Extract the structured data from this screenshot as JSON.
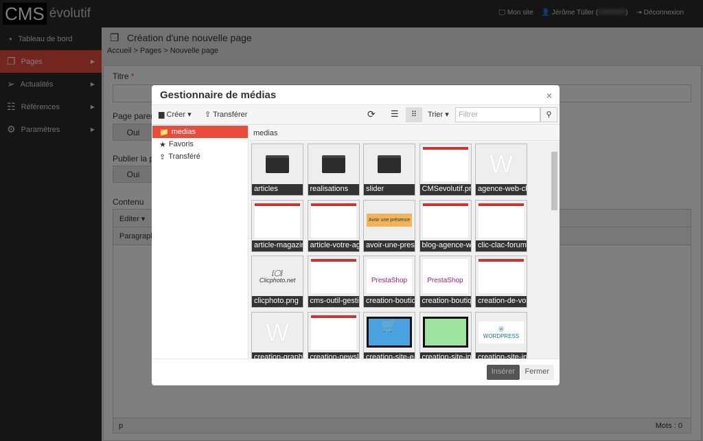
{
  "topbar": {
    "logo_cms": "CMS",
    "logo_evo": "évolutif",
    "my_site": "Mon site",
    "user": "Jérôme Tüller (",
    "user_end": ")",
    "logout": "Déconnexion"
  },
  "sidebar": {
    "items": [
      {
        "label": "Tableau de bord",
        "icon": "dashboard-icon"
      },
      {
        "label": "Pages",
        "icon": "pages-icon",
        "active": true
      },
      {
        "label": "Actualités",
        "icon": "paper-plane-icon"
      },
      {
        "label": "Références",
        "icon": "list-icon"
      },
      {
        "label": "Paramètres",
        "icon": "gear-icon"
      }
    ]
  },
  "page": {
    "title": "Création d'une nouvelle page",
    "breadcrumb": "Accueil > Pages > Nouvelle page",
    "titre_label": "Titre",
    "required": "*",
    "parent_label": "Page parent",
    "oui": "Oui",
    "publish_label": "Publier la p",
    "oui2": "Oui",
    "contenu_label": "Contenu",
    "editer": "Editer ▾",
    "paragraph": "Paragraph",
    "status_p": "p",
    "words": "Mots : 0"
  },
  "modal": {
    "title": "Gestionnaire de médias",
    "close": "×",
    "create": "Créer ▾",
    "upload": "Transférer",
    "sort": "Trier ▾",
    "filter_placeholder": "Filtrer",
    "path": "medias",
    "tree": [
      {
        "label": "medias",
        "active": true
      },
      {
        "label": "Favoris"
      },
      {
        "label": "Transféré"
      }
    ],
    "insert": "Insérer",
    "cancel": "Fermer",
    "files": [
      {
        "name": "articles",
        "type": "folder"
      },
      {
        "name": "realisations",
        "type": "folder"
      },
      {
        "name": "slider",
        "type": "folder"
      },
      {
        "name": "CMSevolutif.png",
        "type": "image"
      },
      {
        "name": "agence-web-ch",
        "type": "image"
      },
      {
        "name": "article-magazin",
        "type": "image"
      },
      {
        "name": "article-votre-ag",
        "type": "image"
      },
      {
        "name": "avoir-une-prese",
        "type": "image"
      },
      {
        "name": "blog-agence-we",
        "type": "image"
      },
      {
        "name": "clic-clac-forum-",
        "type": "image"
      },
      {
        "name": "clicphoto.png",
        "type": "image"
      },
      {
        "name": "cms-outil-gestio",
        "type": "image"
      },
      {
        "name": "creation-boutiq",
        "type": "image"
      },
      {
        "name": "creation-boutiq",
        "type": "image"
      },
      {
        "name": "creation-de-vos",
        "type": "image"
      },
      {
        "name": "creation-graphi",
        "type": "image"
      },
      {
        "name": "creation-newsle",
        "type": "image"
      },
      {
        "name": "creation-site-e-",
        "type": "image"
      },
      {
        "name": "creation-site-ins",
        "type": "image"
      },
      {
        "name": "creation-site-inf",
        "type": "image"
      }
    ],
    "thumb_text": {
      "avoir": "Avoir une présence",
      "clicphoto": "Clicphoto.net",
      "presta": "PrestaShop",
      "wp": "WordPress",
      "w": "W"
    }
  },
  "colors": {
    "accent": "#e74c3c",
    "dark": "#2b2b2b"
  }
}
